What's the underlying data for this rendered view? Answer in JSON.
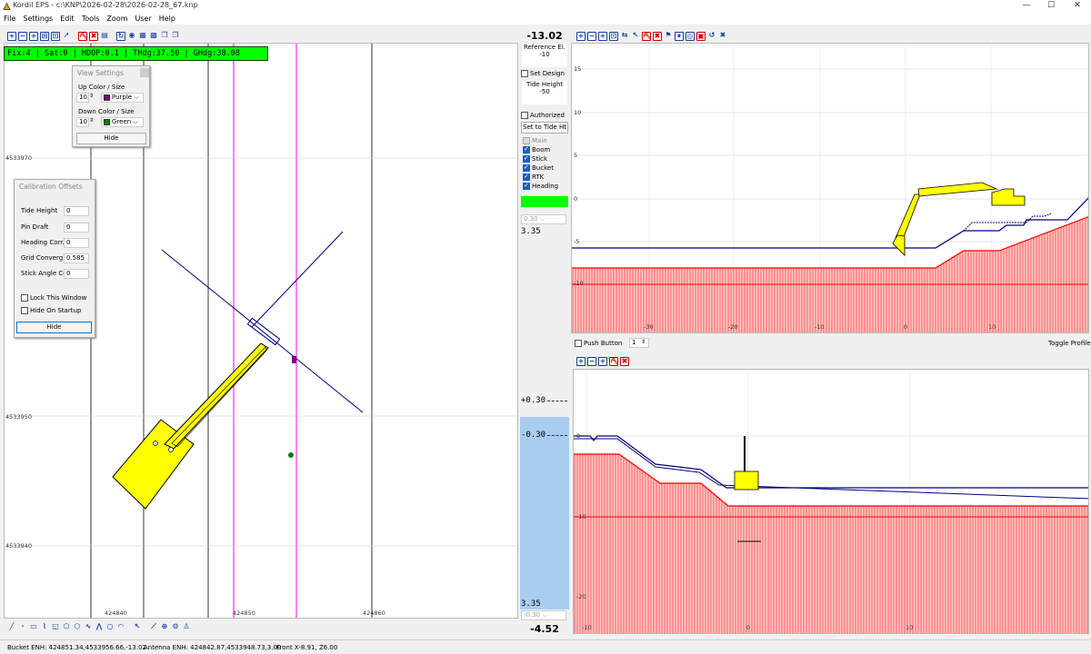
{
  "window": {
    "title": "Kordil EPS - c:\\KNP\\2026-02-28\\2026-02-28_67.knp",
    "min": "—",
    "max": "☐",
    "close": "✕"
  },
  "menu": [
    "File",
    "Settings",
    "Edit",
    "Tools",
    "Zoom",
    "User",
    "Help"
  ],
  "status": {
    "fix": "Fix:4",
    "sat": "Sat:0",
    "hdop": "HDOP:0.1",
    "thdg": "THdg:37.50",
    "ghdg": "GHdg:38.08"
  },
  "view_settings": {
    "title": "View Settings",
    "up_label": "Up Color / Size",
    "up_size": "10",
    "up_color": "Purple",
    "up_hex": "#800080",
    "down_label": "Down Color / Size",
    "down_size": "10",
    "down_color": "Green",
    "down_hex": "#008000",
    "hide": "Hide"
  },
  "calibration": {
    "title": "Calibration Offsets",
    "fields": [
      {
        "label": "Tide Height",
        "value": "0"
      },
      {
        "label": "Pin Draft",
        "value": "0"
      },
      {
        "label": "Heading Corr.",
        "value": "0"
      },
      {
        "label": "Grid Converg.",
        "value": "0.585"
      },
      {
        "label": "Stick Angle Cor.",
        "value": "0"
      }
    ],
    "lock": "Lock This Window",
    "hide_startup": "Hide On Startup",
    "hide": "Hide"
  },
  "plan": {
    "y_ticks": [
      "4533970",
      "4533950",
      "4533940"
    ],
    "x_ticks": [
      "424840",
      "424850",
      "424860"
    ]
  },
  "mid": {
    "depth": "-13.02",
    "ref_label": "Reference El.",
    "ref_value": "-10",
    "set_design": "Set Design",
    "tide_label": "Tide Height",
    "tide_value": "-50",
    "authorized": "Authorized",
    "set_tide": "Set to Tide Ht",
    "checks": [
      {
        "label": "Main",
        "on": false
      },
      {
        "label": "Boom",
        "on": true
      },
      {
        "label": "Stick",
        "on": true
      },
      {
        "label": "Bucket",
        "on": true
      },
      {
        "label": "RTK",
        "on": true
      },
      {
        "label": "Heading",
        "on": true
      }
    ],
    "dropdown1": "0.30",
    "scale_top": "3.35",
    "plus_tol": "+0.30",
    "minus_tol": "-0.30",
    "scale_bottom": "3.35",
    "dropdown2": "-0.30",
    "bucket_depth": "-4.52"
  },
  "profile_top": {
    "y_ticks": [
      "15",
      "10",
      "5",
      "0",
      "-5",
      "-10"
    ],
    "x_ticks": [
      "-30",
      "-20",
      "-10",
      "0",
      "10"
    ]
  },
  "push": {
    "label": "Push Button",
    "value": "1",
    "toggle": "Toggle Profile"
  },
  "profile_bottom": {
    "y_ticks": [
      "0",
      "-10",
      "-20"
    ],
    "x_ticks": [
      "-10",
      "0",
      "10"
    ]
  },
  "bottom": {
    "bucket": "Bucket ENH: 424851.34,4533956.66,-13.02",
    "antenna": "Antenna ENH: 424842.87,4533948.73,3.00",
    "front": "Front X-8.91, Z6.00"
  },
  "colors": {
    "status_green": "#00ff00",
    "excavator": "#ffff00",
    "dredge_line": "#000080",
    "seabed": "#ff0000"
  }
}
